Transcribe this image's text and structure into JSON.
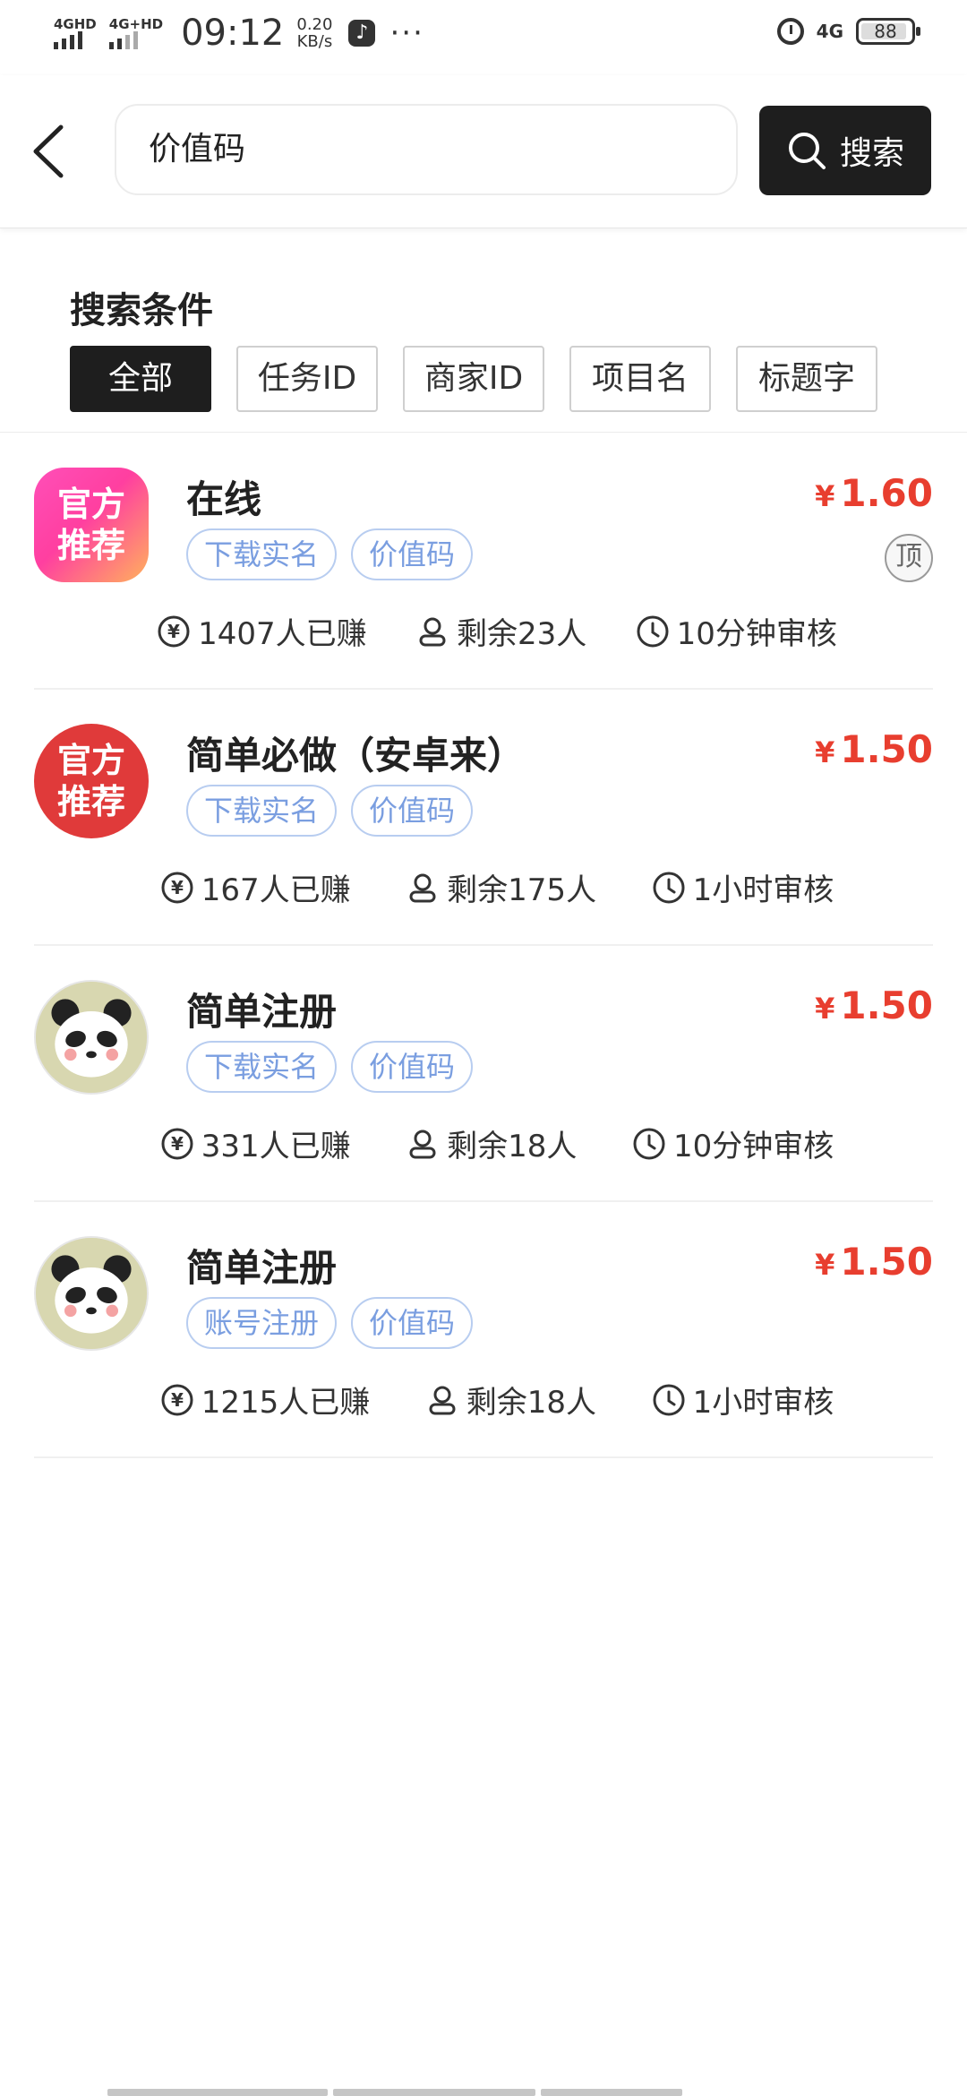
{
  "status_bar": {
    "signal1_label": "4GHD",
    "signal2_label": "4G+HD",
    "time": "09:12",
    "speed_value": "0.20",
    "speed_unit": "KB/s",
    "dots": "···",
    "net_type": "4G",
    "battery": "88"
  },
  "search": {
    "query": "价值码",
    "button_label": "搜索"
  },
  "filter": {
    "title": "搜索条件",
    "chips": [
      {
        "label": "全部",
        "active": true
      },
      {
        "label": "任务ID",
        "active": false
      },
      {
        "label": "商家ID",
        "active": false
      },
      {
        "label": "项目名",
        "active": false
      },
      {
        "label": "标题字",
        "active": false
      }
    ]
  },
  "tasks": [
    {
      "logo_text": [
        "官方",
        "推荐"
      ],
      "logo_style": "pink",
      "title": "在线",
      "currency": "¥",
      "price": "1.60",
      "pinned_badge": "顶",
      "tags": [
        "下载实名",
        "价值码"
      ],
      "earned": "1407人已赚",
      "remaining": "剩余23人",
      "review": "10分钟审核"
    },
    {
      "logo_text": [
        "官方",
        "推荐"
      ],
      "logo_style": "red",
      "title": "简单必做（安卓来）",
      "currency": "¥",
      "price": "1.50",
      "tags": [
        "下载实名",
        "价值码"
      ],
      "earned": "167人已赚",
      "remaining": "剩余175人",
      "review": "1小时审核"
    },
    {
      "logo_style": "panda",
      "title": "简单注册",
      "currency": "¥",
      "price": "1.50",
      "tags": [
        "下载实名",
        "价值码"
      ],
      "earned": "331人已赚",
      "remaining": "剩余18人",
      "review": "10分钟审核"
    },
    {
      "logo_style": "panda",
      "title": "简单注册",
      "currency": "¥",
      "price": "1.50",
      "tags": [
        "账号注册",
        "价值码"
      ],
      "earned": "1215人已赚",
      "remaining": "剩余18人",
      "review": "1小时审核"
    }
  ],
  "colors": {
    "price_red": "#e83e2f",
    "tag_blue": "#7a9ee0",
    "dark_button": "#1e1e1e"
  }
}
